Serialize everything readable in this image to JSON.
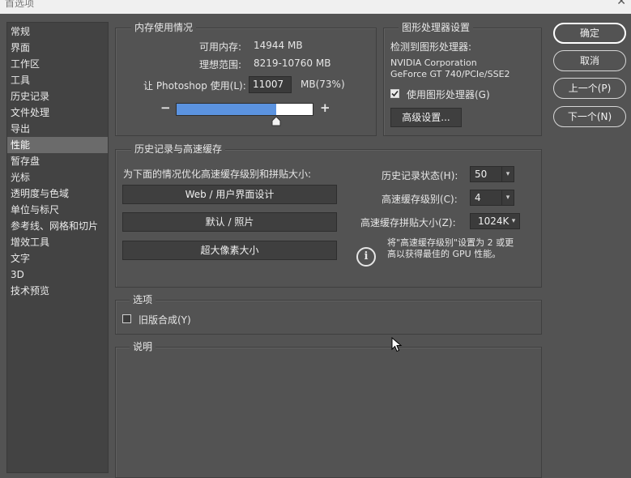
{
  "window": {
    "title": "首选项",
    "close_glyph": "✕"
  },
  "sidebar": {
    "items": [
      {
        "label": "常规"
      },
      {
        "label": "界面"
      },
      {
        "label": "工作区"
      },
      {
        "label": "工具"
      },
      {
        "label": "历史记录"
      },
      {
        "label": "文件处理"
      },
      {
        "label": "导出"
      },
      {
        "label": "性能",
        "selected": true
      },
      {
        "label": "暂存盘"
      },
      {
        "label": "光标"
      },
      {
        "label": "透明度与色域"
      },
      {
        "label": "单位与标尺"
      },
      {
        "label": "参考线、网格和切片"
      },
      {
        "label": "增效工具"
      },
      {
        "label": "文字"
      },
      {
        "label": "3D"
      },
      {
        "label": "技术预览"
      }
    ]
  },
  "memory": {
    "title": "内存使用情况",
    "available_label": "可用内存:",
    "available_value": "14944 MB",
    "ideal_label": "理想范围:",
    "ideal_value": "8219-10760 MB",
    "use_label": "让 Photoshop 使用(L):",
    "use_value": "11007",
    "use_unit": "MB(73%)",
    "minus": "−",
    "plus": "+",
    "slider_fraction": 0.73
  },
  "gpu": {
    "title": "图形处理器设置",
    "detected_label": "检测到图形处理器:",
    "vendor": "NVIDIA Corporation",
    "model": "GeForce GT 740/PCIe/SSE2",
    "use_gpu_label": "使用图形处理器(G)",
    "use_gpu_checked": true,
    "advanced_button": "高级设置..."
  },
  "history_cache": {
    "title": "历史记录与高速缓存",
    "optimize_label": "为下面的情况优化高速缓存级别和拼贴大小:",
    "preset_buttons": [
      "Web / 用户界面设计",
      "默认 / 照片",
      "超大像素大小"
    ],
    "history_states_label": "历史记录状态(H):",
    "history_states_value": "50",
    "cache_levels_label": "高速缓存级别(C):",
    "cache_levels_value": "4",
    "tile_size_label": "高速缓存拼贴大小(Z):",
    "tile_size_value": "1024K",
    "info_line1": "将\"高速缓存级别\"设置为 2 或更",
    "info_line2": "高以获得最佳的 GPU 性能。",
    "info_icon": "i"
  },
  "options": {
    "title": "选项",
    "legacy_label": "旧版合成(Y)",
    "legacy_checked": false
  },
  "description": {
    "title": "说明"
  },
  "actions": {
    "ok": "确定",
    "cancel": "取消",
    "prev": "上一个(P)",
    "next": "下一个(N)"
  },
  "colors": {
    "background": "#535353",
    "slider_fill": "#5b93e0",
    "selected_item": "#6b6b6b"
  }
}
